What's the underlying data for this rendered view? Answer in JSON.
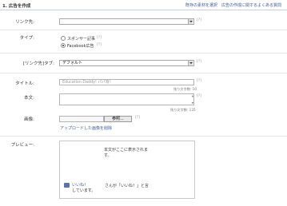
{
  "header": {
    "title": "1. 広告を作成",
    "links": [
      "既存の素材を選択",
      "広告の作成に関するよくある質問"
    ]
  },
  "form": {
    "link_url": {
      "label": "リンク先:",
      "value": "",
      "help": "[?]"
    },
    "type": {
      "label": "タイプ:",
      "options": [
        {
          "label": "スポンサー記事",
          "selected": false,
          "help": "[?]"
        },
        {
          "label": "Facebook広告",
          "selected": true,
          "help": "[?]"
        }
      ]
    },
    "link_type": {
      "label": "[リンク先]タブ:",
      "value": "デフォルト",
      "help": "[?]"
    },
    "title": {
      "label": "タイトル:",
      "value": "Education Daddy! パパ育！",
      "count": "残り文字数: 10",
      "help": "[?]"
    },
    "body": {
      "label": "本文:",
      "value": "",
      "count": "残り文字数: 135",
      "help": "[?]"
    },
    "image": {
      "label": "画像:",
      "browse_label": "参照...",
      "delete_label": "アップロードした画像を削除",
      "help": "[?]"
    },
    "preview": {
      "label": "プレビュー:",
      "body_text": "本文がここに表示されます。",
      "like_label": "いいね！",
      "like_suffix": "しています。",
      "like_message": "さんが「いいね！」と言"
    }
  },
  "colors": {
    "link": "#3b5998",
    "border": "#b5b5b5"
  }
}
